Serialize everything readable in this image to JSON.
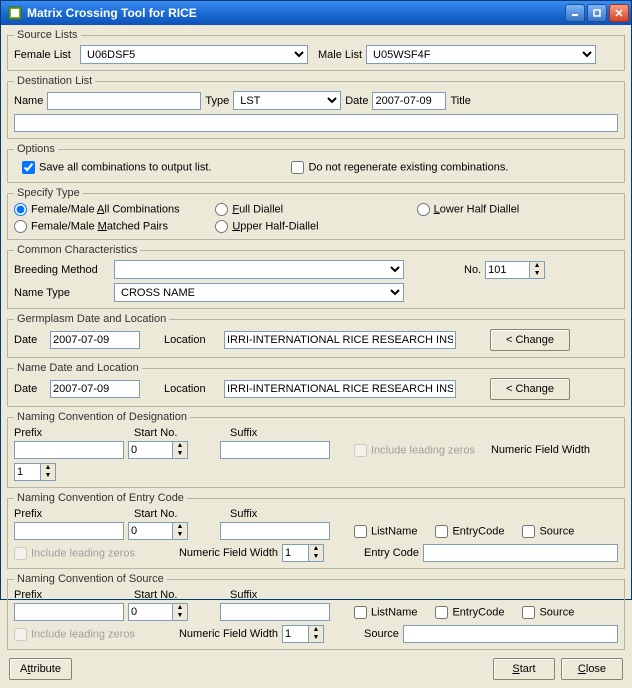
{
  "window": {
    "title": "Matrix Crossing Tool for RICE"
  },
  "sourceLists": {
    "legend": "Source Lists",
    "femaleLabel": "Female List",
    "femaleValue": "U06DSF5",
    "maleLabel": "Male  List",
    "maleValue": "U05WSF4F"
  },
  "destination": {
    "legend": "Destination List",
    "nameLabel": "Name",
    "nameValue": "",
    "typeLabel": "Type",
    "typeValue": "LST",
    "dateLabel": "Date",
    "dateValue": "2007-07-09",
    "titleLabel": "Title",
    "titleValue": ""
  },
  "options": {
    "legend": "Options",
    "saveAll": "Save all combinations to output list.",
    "noRegen": "Do not regenerate existing combinations."
  },
  "specifyType": {
    "legend": "Specify Type",
    "allComb": "Female/Male All Combinations",
    "matched": "Female/Male Matched Pairs",
    "fullDiallel": "Full Diallel",
    "upperHalf": "Upper Half-Diallel",
    "lowerHalf": "Lower Half Diallel"
  },
  "common": {
    "legend": "Common Characteristics",
    "breedingLabel": "Breeding Method",
    "breedingValue": "",
    "noLabel": "No.",
    "noValue": "101",
    "nameTypeLabel": "Name Type",
    "nameTypeValue": "CROSS NAME"
  },
  "germplasm": {
    "legend": "Germplasm Date and Location",
    "dateLabel": "Date",
    "dateValue": "2007-07-09",
    "locLabel": "Location",
    "locValue": "IRRI-INTERNATIONAL RICE RESEARCH INSTITUTE, LO",
    "changeLabel": "< Change"
  },
  "nameDate": {
    "legend": "Name Date and Location",
    "dateLabel": "Date",
    "dateValue": "2007-07-09",
    "locLabel": "Location",
    "locValue": "IRRI-INTERNATIONAL RICE RESEARCH INSTITUTE, LO",
    "changeLabel": "< Change"
  },
  "naming": {
    "prefixLabel": "Prefix",
    "startLabel": "Start No.",
    "suffixLabel": "Suffix",
    "includeLeading": "Include leading zeros",
    "numericWidth": "Numeric Field Width",
    "startValue": "0",
    "widthValue": "1",
    "listNameLabel": "ListName",
    "entryCodeLabel": "EntryCode",
    "sourceLabel": "Source",
    "entryCodeFieldLabel": "Entry Code",
    "sourceFieldLabel": "Source"
  },
  "sections": {
    "designation": "Naming Convention of Designation",
    "entryCode": "Naming Convention of Entry Code",
    "source": "Naming Convention of Source"
  },
  "footer": {
    "attribute": "Attribute",
    "start": "Start",
    "close": "Close"
  }
}
